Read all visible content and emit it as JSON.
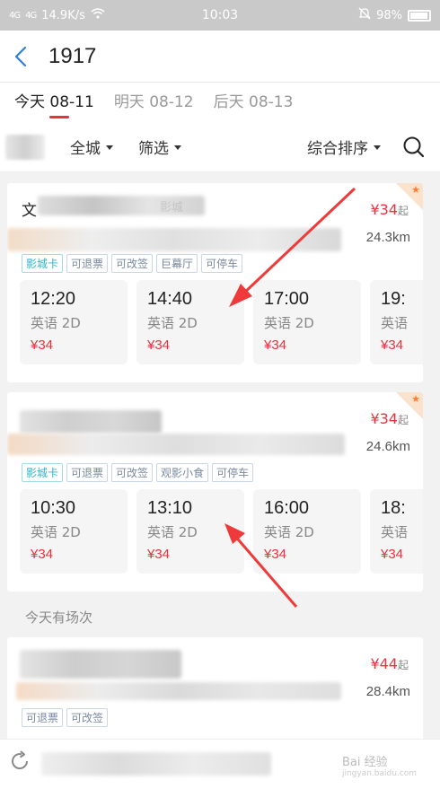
{
  "status": {
    "signal1": "4G",
    "signal2": "4G",
    "speed": "14.9K/s",
    "time": "10:03",
    "battery": "98%"
  },
  "header": {
    "title": "1917"
  },
  "date_tabs": [
    {
      "label": "今天 08-11"
    },
    {
      "label": "明天 08-12"
    },
    {
      "label": "后天 08-13"
    }
  ],
  "filters": {
    "city": "全城",
    "filter": "筛选",
    "sort": "综合排序"
  },
  "cinemas": [
    {
      "name_visible": "文",
      "name_tail": "影城",
      "price": "¥34",
      "price_suffix": "起",
      "distance": "24.3km",
      "tags": [
        "影城卡",
        "可退票",
        "可改签",
        "巨幕厅",
        "可停车"
      ],
      "shows": [
        {
          "time": "12:20",
          "lang": "英语 2D",
          "price": "¥34"
        },
        {
          "time": "14:40",
          "lang": "英语 2D",
          "price": "¥34"
        },
        {
          "time": "17:00",
          "lang": "英语 2D",
          "price": "¥34"
        },
        {
          "time": "19:",
          "lang": "英语",
          "price": "¥34"
        }
      ]
    },
    {
      "price": "¥34",
      "price_suffix": "起",
      "distance": "24.6km",
      "tags": [
        "影城卡",
        "可退票",
        "可改签",
        "观影小食",
        "可停车"
      ],
      "shows": [
        {
          "time": "10:30",
          "lang": "英语 2D",
          "price": "¥34"
        },
        {
          "time": "13:10",
          "lang": "英语 2D",
          "price": "¥34"
        },
        {
          "time": "16:00",
          "lang": "英语 2D",
          "price": "¥34"
        },
        {
          "time": "18:",
          "lang": "英语",
          "price": "¥34"
        }
      ]
    },
    {
      "price": "¥44",
      "price_suffix": "起",
      "distance": "28.4km",
      "tags": [
        "可退票",
        "可改签"
      ]
    }
  ],
  "section_today": "今天有场次",
  "watermark": {
    "main": "Bai 经验",
    "sub": "jingyan.baidu.com"
  }
}
